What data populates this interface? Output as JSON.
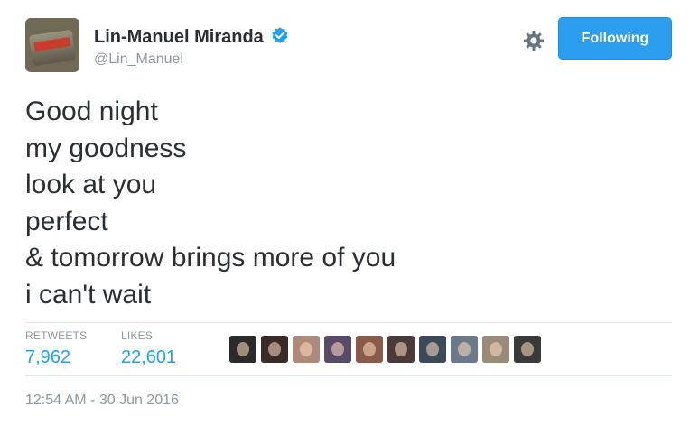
{
  "author": {
    "display_name": "Lin-Manuel Miranda",
    "handle": "@Lin_Manuel",
    "verified": true
  },
  "actions": {
    "follow_label": "Following",
    "settings_icon": "gear-icon"
  },
  "tweet": {
    "lines": [
      "Good night",
      "my goodness",
      "look at you",
      "perfect",
      "& tomorrow brings more of you",
      "i can't wait"
    ]
  },
  "stats": {
    "retweets_label": "RETWEETS",
    "retweets_value": "7,962",
    "likes_label": "LIKES",
    "likes_value": "22,601"
  },
  "likers": [
    {
      "color": "#2b2b2b"
    },
    {
      "color": "#3b2a2a"
    },
    {
      "color": "#b08a78"
    },
    {
      "color": "#5a4a6a"
    },
    {
      "color": "#8a5a4a"
    },
    {
      "color": "#4a3a3a"
    },
    {
      "color": "#3a4a5a"
    },
    {
      "color": "#6a7a8a"
    },
    {
      "color": "#9a8a7a"
    },
    {
      "color": "#3a3a3a"
    }
  ],
  "timestamp": "12:54 AM - 30 Jun 2016",
  "colors": {
    "accent": "#1da1f2",
    "button": "#2b9ef0",
    "muted": "#8899a6",
    "text": "#292f33"
  }
}
